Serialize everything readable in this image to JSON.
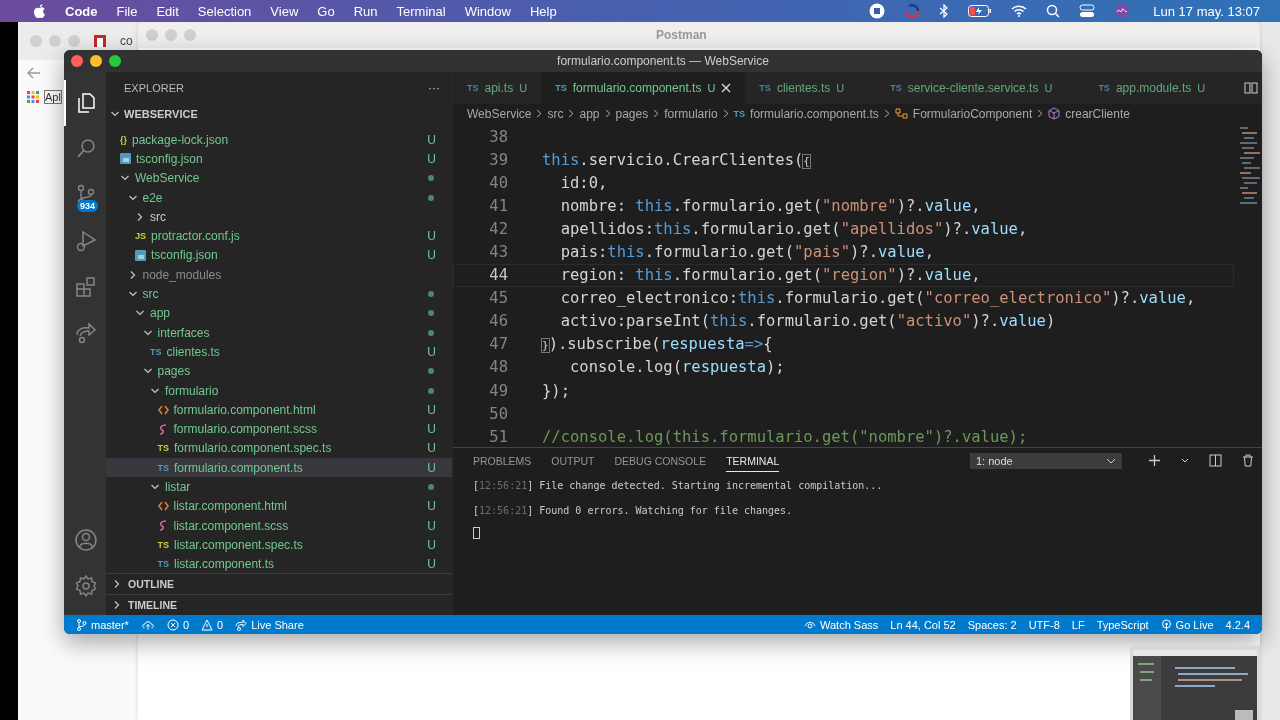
{
  "menu_bar": {
    "app": "Code",
    "items": [
      "File",
      "Edit",
      "Selection",
      "View",
      "Go",
      "Run",
      "Terminal",
      "Window",
      "Help"
    ],
    "clock": "Lun 17 may.  13:07"
  },
  "background": {
    "browser_tab": "co",
    "bookmark": "Apl",
    "postman_title": "Postman"
  },
  "window": {
    "title": "formulario.component.ts — WebService"
  },
  "activity_bar": {
    "items": [
      {
        "kind": "explorer",
        "selected": true
      },
      {
        "kind": "search",
        "selected": false
      },
      {
        "kind": "source-control",
        "selected": false,
        "badge": "934"
      },
      {
        "kind": "run",
        "selected": false
      },
      {
        "kind": "extensions",
        "selected": false
      },
      {
        "kind": "live-share",
        "selected": false
      }
    ]
  },
  "sidebar": {
    "title": "EXPLORER",
    "more": "···",
    "root": "WEBSERVICE",
    "tree": [
      {
        "name": "package-lock.json",
        "kind": "json",
        "glyph": "{}",
        "badge": "U",
        "selected": false
      },
      {
        "name": "tsconfig.json",
        "kind": "tsconfig",
        "badge": "U",
        "selected": false
      },
      {
        "name": "WebService",
        "kind": "folder",
        "expanded": true,
        "dot": true,
        "children": [
          {
            "name": "e2e",
            "kind": "folder",
            "expanded": true,
            "dot": true,
            "children": [
              {
                "name": "src",
                "kind": "folder",
                "expanded": false,
                "dot": false
              },
              {
                "name": "protractor.conf.js",
                "kind": "js",
                "glyph": "JS",
                "badge": "U",
                "selected": false
              },
              {
                "name": "tsconfig.json",
                "kind": "tsconfig",
                "badge": "U",
                "selected": false
              }
            ]
          },
          {
            "name": "node_modules",
            "kind": "folder",
            "expanded": false,
            "dot": false,
            "ignored": true
          },
          {
            "name": "src",
            "kind": "folder",
            "expanded": true,
            "dot": true,
            "children": [
              {
                "name": "app",
                "kind": "folder",
                "expanded": true,
                "dot": true,
                "children": [
                  {
                    "name": "interfaces",
                    "kind": "folder",
                    "expanded": true,
                    "dot": true,
                    "children": [
                      {
                        "name": "clientes.ts",
                        "kind": "ts",
                        "glyph": "TS",
                        "badge": "U",
                        "selected": false
                      }
                    ]
                  },
                  {
                    "name": "pages",
                    "kind": "folder",
                    "expanded": true,
                    "dot": true,
                    "children": [
                      {
                        "name": "formulario",
                        "kind": "folder",
                        "expanded": true,
                        "dot": true,
                        "children": [
                          {
                            "name": "formulario.component.html",
                            "kind": "html",
                            "badge": "U",
                            "selected": false
                          },
                          {
                            "name": "formulario.component.scss",
                            "kind": "scss",
                            "badge": "U",
                            "selected": false
                          },
                          {
                            "name": "formulario.component.spec.ts",
                            "kind": "spec",
                            "glyph": "TS",
                            "badge": "U",
                            "selected": false
                          },
                          {
                            "name": "formulario.component.ts",
                            "kind": "ts",
                            "glyph": "TS",
                            "badge": "U",
                            "selected": true
                          }
                        ]
                      },
                      {
                        "name": "listar",
                        "kind": "folder",
                        "expanded": true,
                        "dot": true,
                        "children": [
                          {
                            "name": "listar.component.html",
                            "kind": "html",
                            "badge": "U",
                            "selected": false
                          },
                          {
                            "name": "listar.component.scss",
                            "kind": "scss",
                            "badge": "U",
                            "selected": false
                          },
                          {
                            "name": "listar.component.spec.ts",
                            "kind": "spec",
                            "glyph": "TS",
                            "badge": "U",
                            "selected": false
                          },
                          {
                            "name": "listar.component.ts",
                            "kind": "ts",
                            "glyph": "TS",
                            "badge": "U",
                            "selected": false
                          }
                        ]
                      }
                    ]
                  }
                ]
              }
            ]
          }
        ]
      }
    ],
    "sections": [
      {
        "label": "OUTLINE",
        "expanded": false
      },
      {
        "label": "TIMELINE",
        "expanded": false
      }
    ]
  },
  "tabs": [
    {
      "glyph": "TS",
      "label": "api.ts",
      "badge": "U",
      "selected": false
    },
    {
      "glyph": "TS",
      "label": "formulario.component.ts",
      "badge": "U",
      "selected": true
    },
    {
      "glyph": "TS",
      "label": "clientes.ts",
      "badge": "U",
      "selected": false
    },
    {
      "glyph": "TS",
      "label": "service-cliente.service.ts",
      "badge": "U",
      "selected": false
    },
    {
      "glyph": "TS",
      "label": "app.module.ts",
      "badge": "U",
      "selected": false
    }
  ],
  "breadcrumbs": [
    {
      "kind": "folder",
      "label": "WebService"
    },
    {
      "kind": "folder",
      "label": "src"
    },
    {
      "kind": "folder",
      "label": "app"
    },
    {
      "kind": "folder",
      "label": "pages"
    },
    {
      "kind": "folder",
      "label": "formulario"
    },
    {
      "kind": "file",
      "glyph": "TS",
      "label": "formulario.component.ts"
    },
    {
      "kind": "class",
      "label": "FormularioComponent"
    },
    {
      "kind": "method",
      "label": "crearCliente"
    }
  ],
  "code": [
    {
      "number": "38",
      "current": false
    },
    {
      "number": "39",
      "current": false,
      "tokens": [
        {
          "t": "this",
          "kind": "kw"
        },
        {
          "t": ".servicio.CrearClientes(",
          "kind": "p"
        },
        {
          "t": "{",
          "kind": "bm"
        }
      ]
    },
    {
      "number": "40",
      "current": false,
      "tokens": [
        {
          "t": "  id:0,",
          "kind": "p"
        }
      ]
    },
    {
      "number": "41",
      "current": false,
      "tokens": [
        {
          "t": "  nombre: ",
          "kind": "p"
        },
        {
          "t": "this",
          "kind": "kw"
        },
        {
          "t": ".formulario.get(",
          "kind": "p"
        },
        {
          "t": "\"nombre\"",
          "kind": "str"
        },
        {
          "t": ")?.",
          "kind": "p"
        },
        {
          "t": "value",
          "kind": "prop"
        },
        {
          "t": ",",
          "kind": "p"
        }
      ]
    },
    {
      "number": "42",
      "current": false,
      "tokens": [
        {
          "t": "  apellidos:",
          "kind": "p"
        },
        {
          "t": "this",
          "kind": "kw"
        },
        {
          "t": ".formulario.get(",
          "kind": "p"
        },
        {
          "t": "\"apellidos\"",
          "kind": "str"
        },
        {
          "t": ")?.",
          "kind": "p"
        },
        {
          "t": "value",
          "kind": "prop"
        },
        {
          "t": ",",
          "kind": "p"
        }
      ]
    },
    {
      "number": "43",
      "current": false,
      "tokens": [
        {
          "t": "  pais:",
          "kind": "p"
        },
        {
          "t": "this",
          "kind": "kw"
        },
        {
          "t": ".formulario.get(",
          "kind": "p"
        },
        {
          "t": "\"pais\"",
          "kind": "str"
        },
        {
          "t": ")?.",
          "kind": "p"
        },
        {
          "t": "value",
          "kind": "prop"
        },
        {
          "t": ",",
          "kind": "p"
        }
      ]
    },
    {
      "number": "44",
      "current": true,
      "tokens": [
        {
          "t": "  region: ",
          "kind": "p"
        },
        {
          "t": "this",
          "kind": "kw"
        },
        {
          "t": ".formulario.get(",
          "kind": "p"
        },
        {
          "t": "\"region\"",
          "kind": "str"
        },
        {
          "t": ")?.",
          "kind": "p"
        },
        {
          "t": "value",
          "kind": "prop"
        },
        {
          "t": ",",
          "kind": "p"
        }
      ]
    },
    {
      "number": "45",
      "current": false,
      "tokens": [
        {
          "t": "  correo_electronico:",
          "kind": "p"
        },
        {
          "t": "this",
          "kind": "kw"
        },
        {
          "t": ".formulario.get(",
          "kind": "p"
        },
        {
          "t": "\"correo_electronico\"",
          "kind": "str"
        },
        {
          "t": ")?.",
          "kind": "p"
        },
        {
          "t": "value",
          "kind": "prop"
        },
        {
          "t": ",",
          "kind": "p"
        }
      ]
    },
    {
      "number": "46",
      "current": false,
      "tokens": [
        {
          "t": "  activo:parseInt(",
          "kind": "p"
        },
        {
          "t": "this",
          "kind": "kw"
        },
        {
          "t": ".formulario.get(",
          "kind": "p"
        },
        {
          "t": "\"activo\"",
          "kind": "str"
        },
        {
          "t": ")?.",
          "kind": "p"
        },
        {
          "t": "value",
          "kind": "prop"
        },
        {
          "t": ")",
          "kind": "p"
        }
      ]
    },
    {
      "number": "47",
      "current": false,
      "tokens": [
        {
          "t": "}",
          "kind": "bm"
        },
        {
          "t": ").subscribe(",
          "kind": "p"
        },
        {
          "t": "respuesta",
          "kind": "prop"
        },
        {
          "t": "=>",
          "kind": "kw"
        },
        {
          "t": "{",
          "kind": "p"
        }
      ]
    },
    {
      "number": "48",
      "current": false,
      "tokens": [
        {
          "t": "   console.log(",
          "kind": "p"
        },
        {
          "t": "respuesta",
          "kind": "prop"
        },
        {
          "t": ");",
          "kind": "p"
        }
      ]
    },
    {
      "number": "49",
      "current": false,
      "tokens": [
        {
          "t": "});",
          "kind": "p"
        }
      ]
    },
    {
      "number": "50",
      "current": false
    },
    {
      "number": "51",
      "current": false,
      "tokens": [
        {
          "t": "//console.log(this.formulario.get(\"nombre\")?.value);",
          "kind": "cm"
        }
      ]
    }
  ],
  "panel": {
    "tabs": [
      {
        "label": "PROBLEMS",
        "selected": false
      },
      {
        "label": "OUTPUT",
        "selected": false
      },
      {
        "label": "DEBUG CONSOLE",
        "selected": false
      },
      {
        "label": "TERMINAL",
        "selected": true
      }
    ],
    "terminal_select": "1: node",
    "terminal_lines": [
      {
        "open": "[",
        "time": "12:56:21",
        "text": "] File change detected. Starting incremental compilation..."
      },
      {
        "open": "[",
        "time": "12:56:21",
        "text": "] Found 0 errors. Watching for file changes."
      }
    ]
  },
  "status_bar": {
    "left": [
      {
        "kind": "branch",
        "label": "master*"
      },
      {
        "kind": "sync"
      },
      {
        "kind": "errors",
        "label": "0"
      },
      {
        "kind": "warnings",
        "label": "0"
      },
      {
        "kind": "live-share",
        "label": "Live Share"
      }
    ],
    "right": [
      {
        "kind": "watch",
        "label": "Watch Sass"
      },
      {
        "kind": "text",
        "label": "Ln 44, Col 52"
      },
      {
        "kind": "text",
        "label": "Spaces: 2"
      },
      {
        "kind": "text",
        "label": "UTF-8"
      },
      {
        "kind": "text",
        "label": "LF"
      },
      {
        "kind": "text",
        "label": "TypeScript"
      },
      {
        "kind": "golive",
        "label": "Go Live"
      },
      {
        "kind": "text",
        "label": "4.2.4"
      }
    ]
  }
}
